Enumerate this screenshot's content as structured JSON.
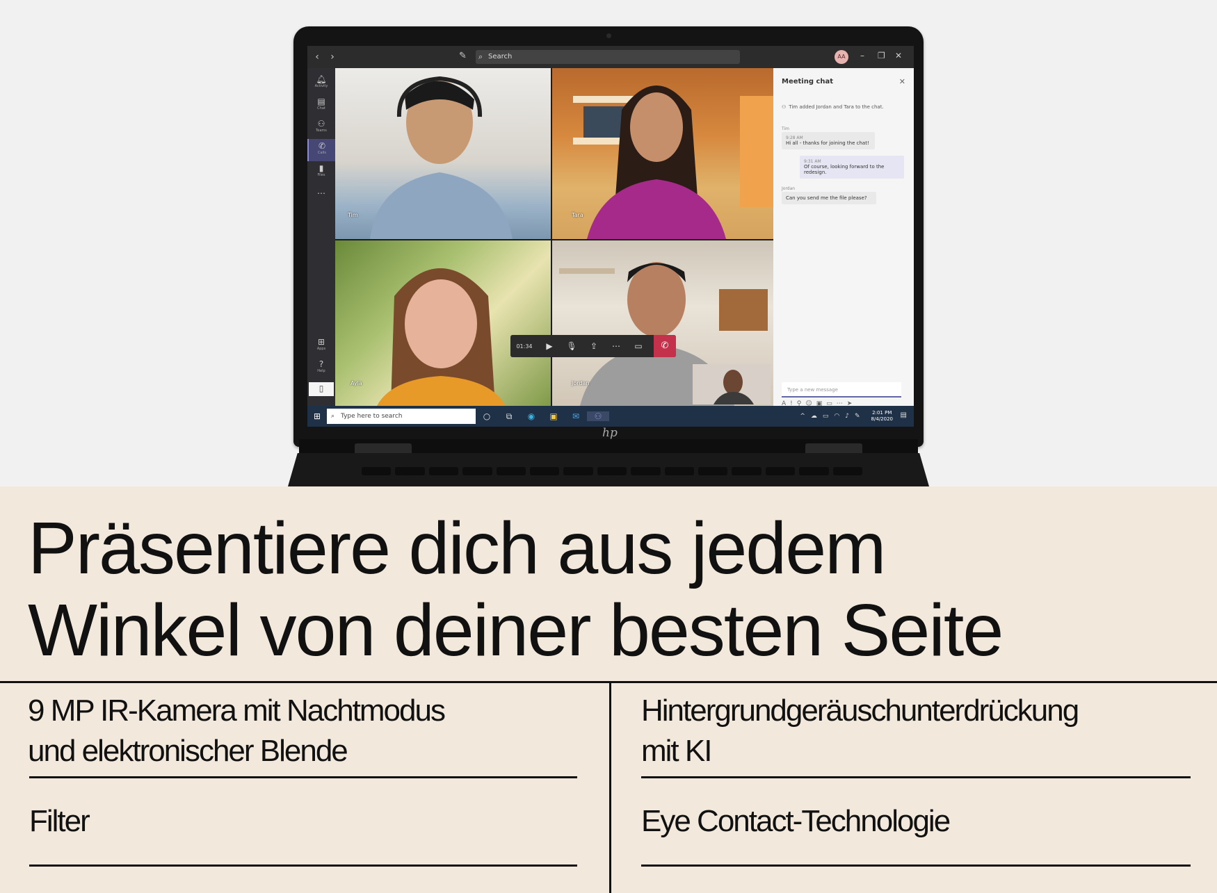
{
  "teams": {
    "search_placeholder": "Search",
    "avatar_initials": "AA",
    "rail": [
      {
        "label": "Activity",
        "icon": "bell-icon"
      },
      {
        "label": "Chat",
        "icon": "chat-icon"
      },
      {
        "label": "Teams",
        "icon": "teams-icon"
      },
      {
        "label": "Calls",
        "icon": "phone-icon"
      },
      {
        "label": "Files",
        "icon": "file-icon"
      },
      {
        "label": "Apps",
        "icon": "apps-icon"
      },
      {
        "label": "Help",
        "icon": "help-icon"
      }
    ],
    "participants": [
      "Tim",
      "Tara",
      "Ayla",
      "Jordan"
    ],
    "call_timer": "01:34",
    "chat": {
      "title": "Meeting chat",
      "system_message": "Tim added Jordan and Tara to the chat.",
      "messages": [
        {
          "author": "Tim",
          "time": "9:28 AM",
          "text": "Hi all - thanks for joining the chat!"
        },
        {
          "author": "",
          "time": "9:31 AM",
          "text": "Of course, looking forward to the redesign."
        },
        {
          "author": "Jordan",
          "time": "",
          "text": "Can you send me the file please?"
        }
      ],
      "input_placeholder": "Type a new message"
    }
  },
  "taskbar": {
    "search_placeholder": "Type here to search",
    "time": "2:01 PM",
    "date": "8/4/2020"
  },
  "brand": "hp",
  "headline": {
    "line1": "Präsentiere dich aus jedem",
    "line2": "Winkel von deiner besten Seite"
  },
  "features": {
    "left_top_1": "9 MP IR-Kamera mit Nachtmodus",
    "left_top_2": "und elektronischer Blende",
    "left_bottom": "Filter",
    "right_top_1": "Hintergrundgeräuschunterdrückung",
    "right_top_2": "mit KI",
    "right_bottom": "Eye Contact-Technologie"
  }
}
